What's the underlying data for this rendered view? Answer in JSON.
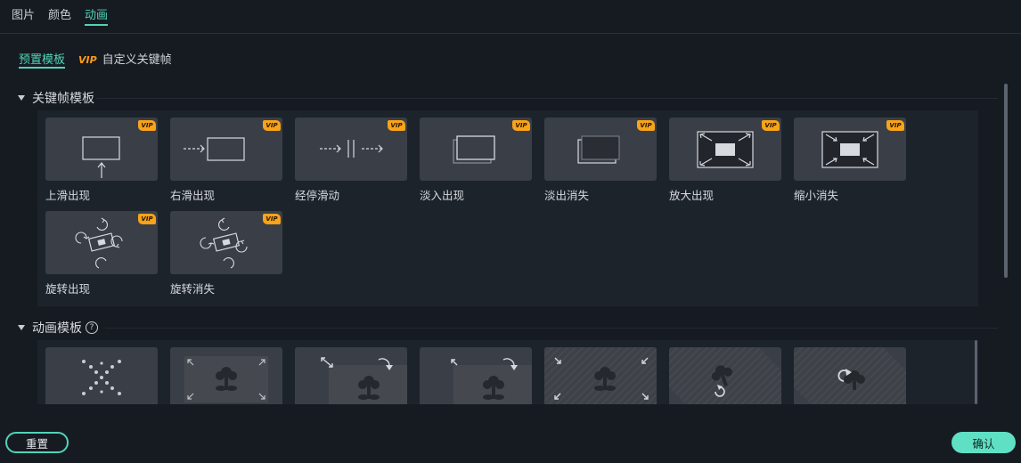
{
  "tabs": [
    "图片",
    "颜色",
    "动画"
  ],
  "subtabs": {
    "preset": "预置模板",
    "vip": "VIP",
    "custom": "自定义关键帧"
  },
  "keyframe_section": {
    "title": "关键帧模板",
    "cards": [
      {
        "label": "上滑出现",
        "vip": "VIP"
      },
      {
        "label": "右滑出现",
        "vip": "VIP"
      },
      {
        "label": "经停滑动",
        "vip": "VIP"
      },
      {
        "label": "淡入出现",
        "vip": "VIP"
      },
      {
        "label": "淡出消失",
        "vip": "VIP"
      },
      {
        "label": "放大出现",
        "vip": "VIP"
      },
      {
        "label": "缩小消失",
        "vip": "VIP"
      },
      {
        "label": "旋转出现",
        "vip": "VIP"
      },
      {
        "label": "旋转消失",
        "vip": "VIP"
      }
    ]
  },
  "anim_section": {
    "title": "动画模板",
    "help": "?"
  },
  "footer": {
    "reset": "重置",
    "confirm": "确认"
  }
}
